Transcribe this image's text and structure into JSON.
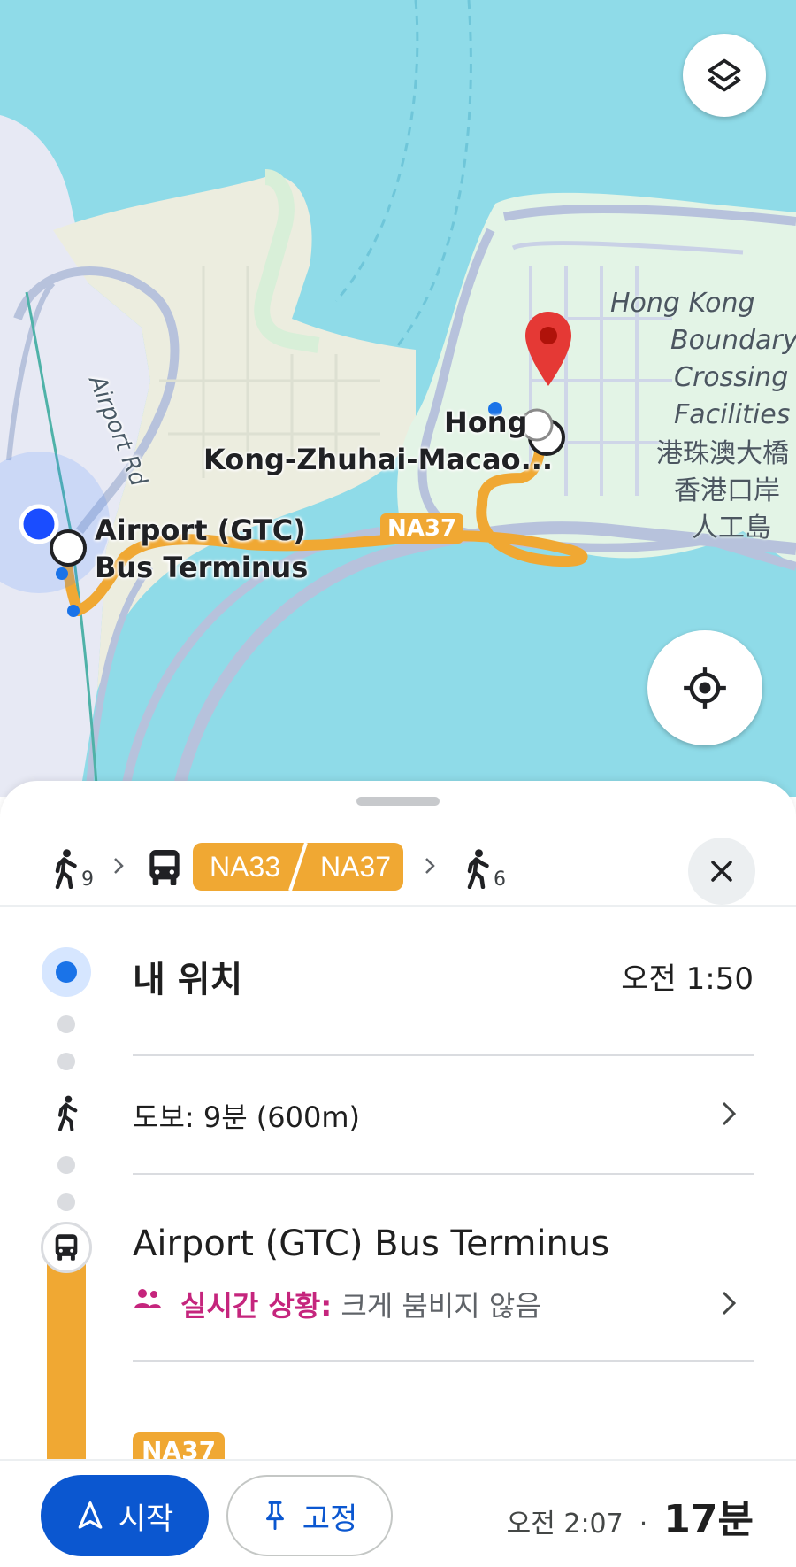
{
  "map": {
    "labels": {
      "airport_rd": "Airport Rd",
      "bus_terminus_line1": "Airport (GTC)",
      "bus_terminus_line2": "Bus Terminus",
      "hzm_line1": "Hong",
      "hzm_line2": "Kong-Zhuhai-Macao...",
      "route_badge": "NA37",
      "boundary_en": [
        "Hong Kong",
        "Boundary",
        "Crossing",
        "Facilities"
      ],
      "boundary_zh": [
        "港珠澳大橋",
        "香港口岸",
        "人工島"
      ]
    },
    "colors": {
      "water": "#8fdbe8",
      "land": "#e8f6ec",
      "route": "#f0a833",
      "pin": "#e53935",
      "road": "#b7c2dc"
    },
    "controls": {
      "layers_icon": "layers-icon",
      "locate_icon": "my-location-icon"
    }
  },
  "summary": {
    "walk_start_minutes": "9",
    "routes": [
      "NA33",
      "NA37"
    ],
    "walk_end_minutes": "6",
    "close_icon": "close-icon"
  },
  "steps": {
    "my_location": {
      "label": "내 위치",
      "time": "오전 1:50"
    },
    "walk": {
      "label": "도보: 9분 (600m)"
    },
    "bus_stop": {
      "name": "Airport (GTC) Bus Terminus",
      "live_label": "실시간 상황:",
      "live_value": " 크게 붐비지 않음"
    },
    "next_route_badge": "NA37"
  },
  "bottom": {
    "start_label": "시작",
    "pin_label": "고정",
    "arrival_time": "오전 2:07",
    "dot": "·",
    "duration": "17분"
  }
}
